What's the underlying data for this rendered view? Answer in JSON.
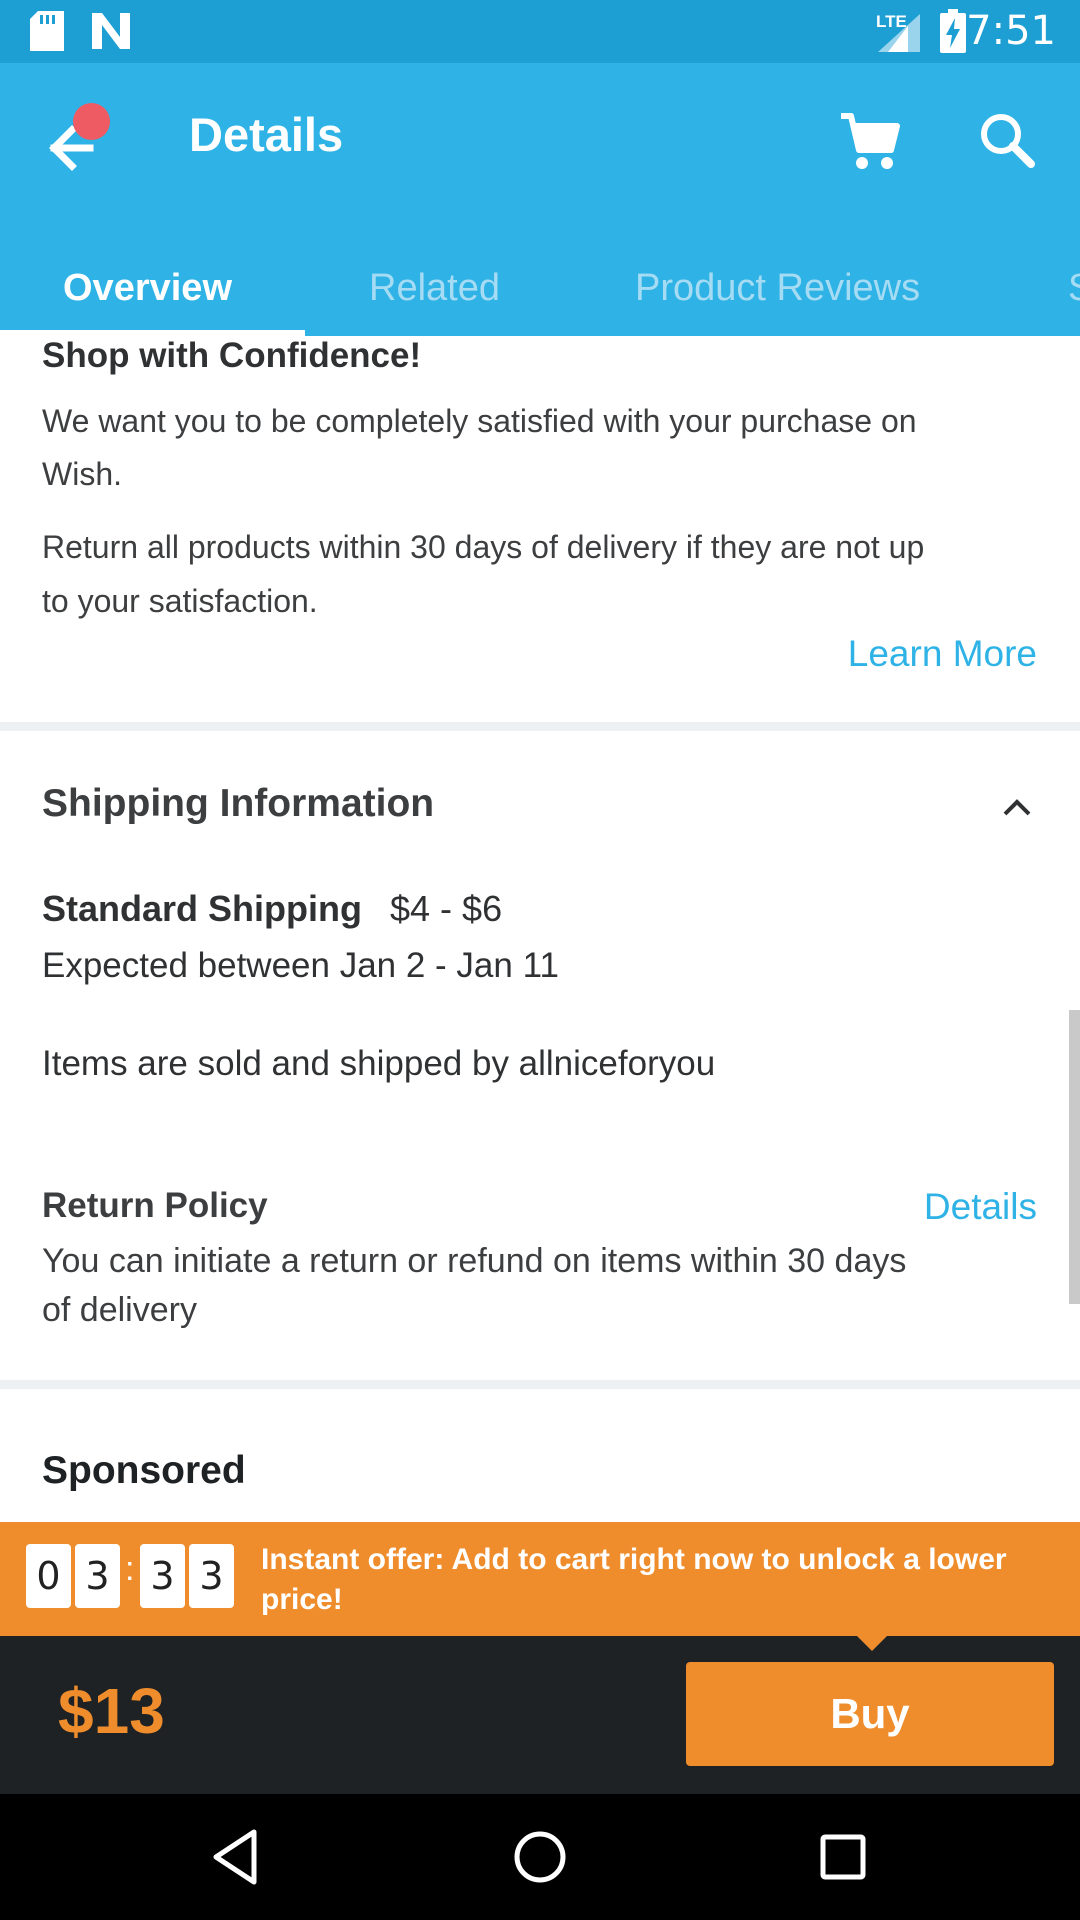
{
  "status_bar": {
    "time": "7:51",
    "network": "LTE"
  },
  "app_bar": {
    "title": "Details"
  },
  "tabs": [
    {
      "label": "Overview"
    },
    {
      "label": "Related"
    },
    {
      "label": "Product Reviews"
    },
    {
      "label": "S"
    }
  ],
  "confidence": {
    "title": "Shop with Confidence!",
    "paragraph1_line1": "We want you to be completely satisfied with your purchase on",
    "paragraph1_line2": "Wish.",
    "paragraph2_line1": "Return all products within 30 days of delivery if they are not up",
    "paragraph2_line2": "to your satisfaction.",
    "link": "Learn More"
  },
  "shipping": {
    "title": "Shipping Information",
    "method_label": "Standard Shipping",
    "method_price": "$4 - $6",
    "expected": "Expected between Jan 2 - Jan 11",
    "seller": "Items are sold and shipped by allniceforyou",
    "return_title": "Return Policy",
    "return_link": "Details",
    "return_line1": "You can initiate a return or refund on items within 30 days",
    "return_line2": "of delivery"
  },
  "sponsored": {
    "title": "Sponsored"
  },
  "offer": {
    "timer": [
      "0",
      "3",
      "3",
      "3"
    ],
    "separator": ":",
    "text": "Instant offer: Add to cart right now to unlock a lower price!"
  },
  "buy_bar": {
    "price": "$13",
    "buy_label": "Buy"
  },
  "colors": {
    "accent": "#2fb3e6",
    "status": "#1e9fd4",
    "offer": "#ef8d2d",
    "dark": "#1f2225"
  }
}
